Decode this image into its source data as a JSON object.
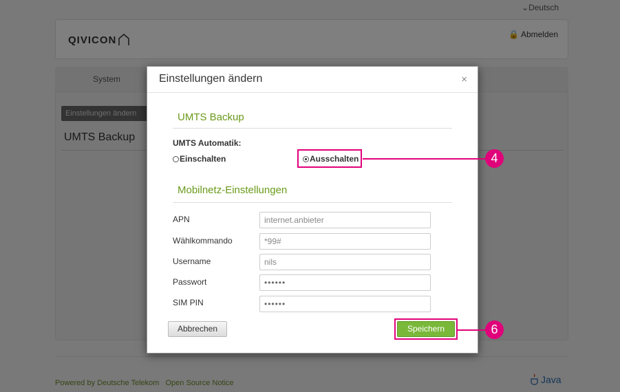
{
  "top": {
    "language": "Deutsch"
  },
  "header": {
    "logo": "QIVICON",
    "logout": "Abmelden"
  },
  "tabs": {
    "system": "System"
  },
  "content": {
    "subtab": "Einstellungen ändern",
    "title": "UMTS Backup"
  },
  "footer": {
    "powered": "Powered by Deutsche Telekom",
    "opensource": "Open Source Notice",
    "java": "Java"
  },
  "dialog": {
    "title": "Einstellungen ändern",
    "close": "×",
    "section_umts": "UMTS Backup",
    "umts_label": "UMTS Automatik:",
    "radio_on": "Einschalten",
    "radio_off": "Ausschalten",
    "radio_selected": "Ausschalten",
    "section_mobile": "Mobilnetz-Einstellungen",
    "fields": [
      {
        "label": "APN",
        "value": "internet.anbieter"
      },
      {
        "label": "Wählkommando",
        "value": "*99#"
      },
      {
        "label": "Username",
        "value": "nils"
      },
      {
        "label": "Passwort",
        "value": "••••••"
      },
      {
        "label": "SIM PIN",
        "value": "••••••"
      }
    ],
    "cancel": "Abbrechen",
    "save": "Speichern"
  },
  "callouts": {
    "radio": "4",
    "save": "6"
  },
  "colors": {
    "accent_green": "#6a9a1a",
    "highlight": "#e0007a",
    "save_button": "#7ab83a"
  }
}
